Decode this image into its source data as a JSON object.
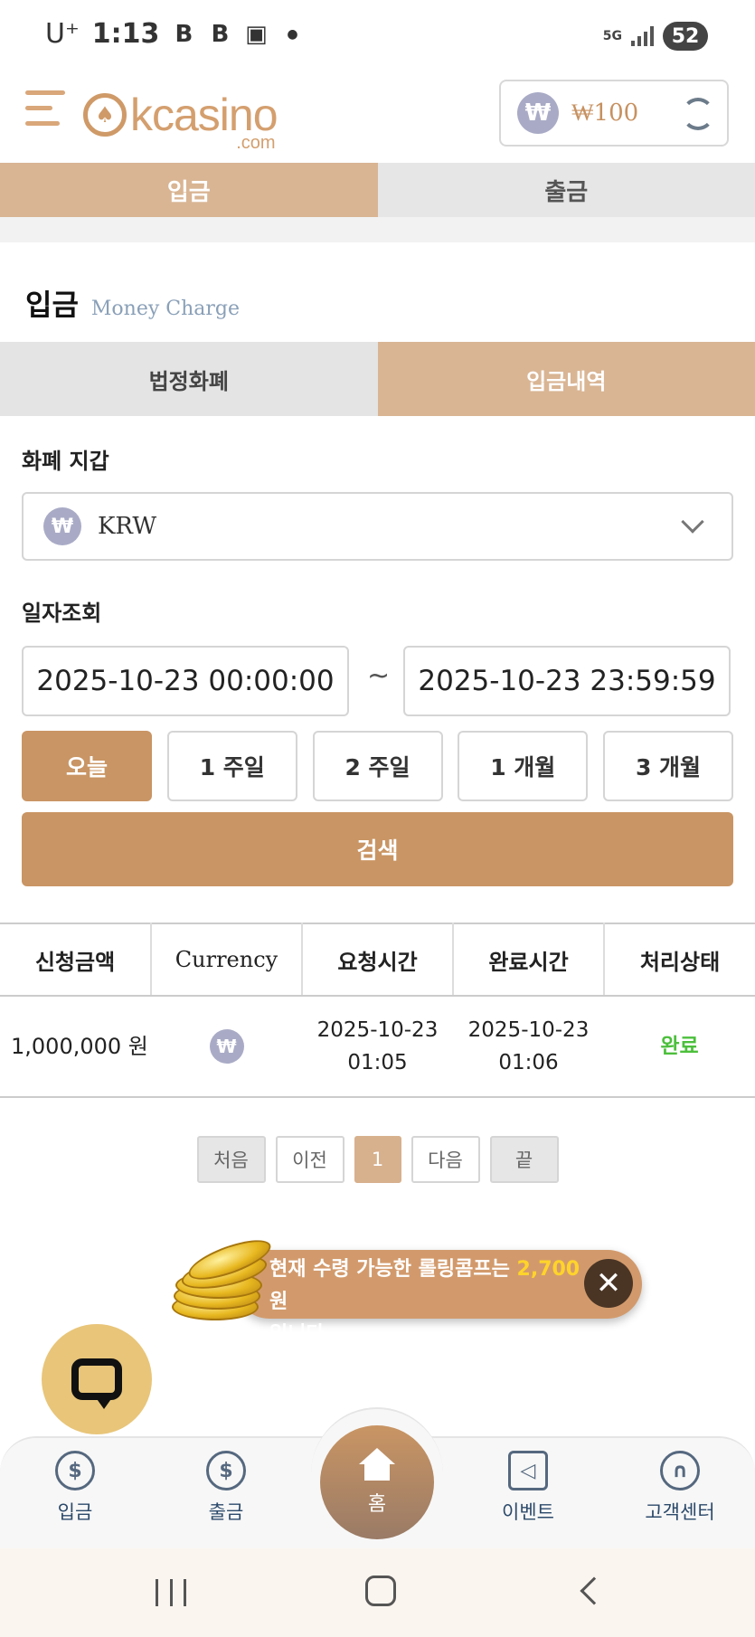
{
  "status_bar": {
    "carrier": "U⁺",
    "time": "1:13",
    "network": "5G",
    "battery": "52"
  },
  "header": {
    "logo_text": "kcasino",
    "logo_sub": ".com",
    "currency_symbol": "₩",
    "balance": "₩100"
  },
  "top_tabs": {
    "deposit": "입금",
    "withdraw": "출금"
  },
  "section": {
    "title": "입금",
    "subtitle": "Money Charge"
  },
  "sub_tabs": {
    "fiat": "법정화폐",
    "history": "입금내역"
  },
  "wallet": {
    "label": "화폐 지갑",
    "selected": "KRW"
  },
  "date_query": {
    "label": "일자조회",
    "from": "2025-10-23 00:00:00",
    "separator": "~",
    "to": "2025-10-23 23:59:59"
  },
  "period_buttons": [
    "오늘",
    "1 주일",
    "2 주일",
    "1 개월",
    "3 개월"
  ],
  "search_label": "검색",
  "table": {
    "headers": [
      "신청금액",
      "Currency",
      "요청시간",
      "완료시간",
      "처리상태"
    ],
    "rows": [
      {
        "amount": "1,000,000 원",
        "currency_icon": "won-icon",
        "request_date": "2025-10-23",
        "request_time": "01:05",
        "complete_date": "2025-10-23",
        "complete_time": "01:06",
        "status": "완료"
      }
    ]
  },
  "pagination": {
    "first": "처음",
    "prev": "이전",
    "current": "1",
    "next": "다음",
    "last": "끝"
  },
  "toast": {
    "text_before": "현재 수령 가능한 롤링콤프는 ",
    "amount": "2,700",
    "text_after": " 원",
    "text_line2": "입니다."
  },
  "bottom_nav": {
    "deposit": "입금",
    "withdraw": "출금",
    "home": "홈",
    "event": "이벤트",
    "support": "고객센터"
  },
  "colors": {
    "accent": "#c99564",
    "tab_active": "#d9b594",
    "status_done": "#4cbf3c",
    "highlight": "#ffd42a"
  }
}
